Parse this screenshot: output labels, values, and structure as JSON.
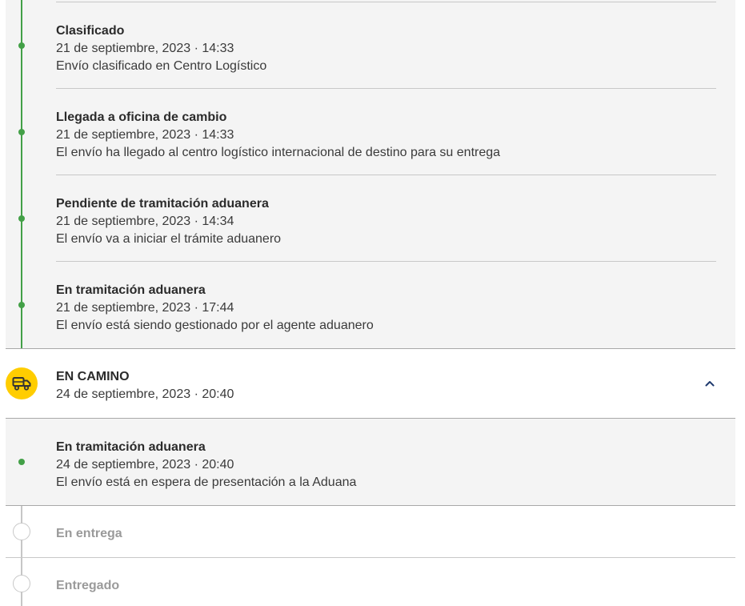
{
  "events_past": [
    {
      "title": "Clasificado",
      "date": "21 de septiembre, 2023 · 14:33",
      "desc": "Envío clasificado en Centro Logístico"
    },
    {
      "title": "Llegada a oficina de cambio",
      "date": "21 de septiembre, 2023 · 14:33",
      "desc": "El envío ha llegado al centro logístico internacional de destino para su entrega"
    },
    {
      "title": "Pendiente de tramitación aduanera",
      "date": "21 de septiembre, 2023 · 14:34",
      "desc": "El envío va a iniciar el trámite aduanero"
    },
    {
      "title": "En tramitación aduanera",
      "date": "21 de septiembre, 2023 · 17:44",
      "desc": "El envío está siendo gestionado por el agente aduanero"
    }
  ],
  "current_stage": {
    "label": "EN CAMINO",
    "date": "24 de septiembre, 2023 · 20:40",
    "icon": "truck-icon",
    "expanded": true,
    "icon_color": "#ffcd00",
    "events": [
      {
        "title": "En tramitación aduanera",
        "date": "24 de septiembre, 2023 · 20:40",
        "desc": "El envío está en espera de presentación a la Aduana"
      }
    ]
  },
  "pending_stages": [
    {
      "label": "En entrega"
    },
    {
      "label": "Entregado"
    }
  ],
  "colors": {
    "progress": "#43a047",
    "pending": "#c6c6c6",
    "accent": "#ffcd00",
    "chevron": "#1f3a6e"
  }
}
